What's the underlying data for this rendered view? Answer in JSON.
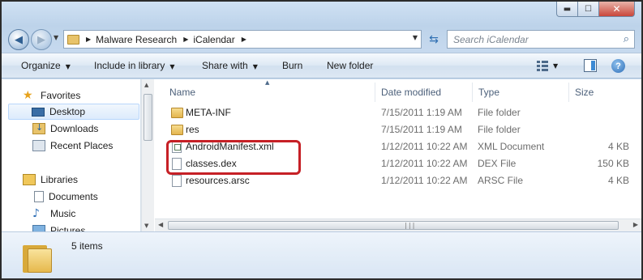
{
  "window": {
    "minimize_glyph": "▬",
    "maximize_glyph": "☐",
    "close_glyph": "✕"
  },
  "address": {
    "crumbs": [
      "Malware Research",
      "iCalendar"
    ],
    "search_placeholder": "Search iCalendar"
  },
  "toolbar": {
    "organize": "Organize",
    "include_in_library": "Include in library",
    "share_with": "Share with",
    "burn": "Burn",
    "new_folder": "New folder",
    "caret": "▼"
  },
  "nav": {
    "favorites": "Favorites",
    "desktop": "Desktop",
    "downloads": "Downloads",
    "recent_places": "Recent Places",
    "libraries": "Libraries",
    "documents": "Documents",
    "music": "Music",
    "pictures": "Pictures"
  },
  "columns": {
    "name": "Name",
    "date_modified": "Date modified",
    "type": "Type",
    "size": "Size"
  },
  "files": [
    {
      "name": "META-INF",
      "date": "7/15/2011 1:19 AM",
      "type": "File folder",
      "size": "",
      "icon": "folder-icon"
    },
    {
      "name": "res",
      "date": "7/15/2011 1:19 AM",
      "type": "File folder",
      "size": "",
      "icon": "folder-icon"
    },
    {
      "name": "AndroidManifest.xml",
      "date": "1/12/2011 10:22 AM",
      "type": "XML Document",
      "size": "4 KB",
      "icon": "xml-file-icon"
    },
    {
      "name": "classes.dex",
      "date": "1/12/2011 10:22 AM",
      "type": "DEX File",
      "size": "150 KB",
      "icon": "file-icon"
    },
    {
      "name": "resources.arsc",
      "date": "1/12/2011 10:22 AM",
      "type": "ARSC File",
      "size": "4 KB",
      "icon": "file-icon"
    }
  ],
  "status": {
    "item_count": "5 items"
  },
  "colors": {
    "highlight": "#c62026",
    "accent": "#3a6ea5"
  }
}
